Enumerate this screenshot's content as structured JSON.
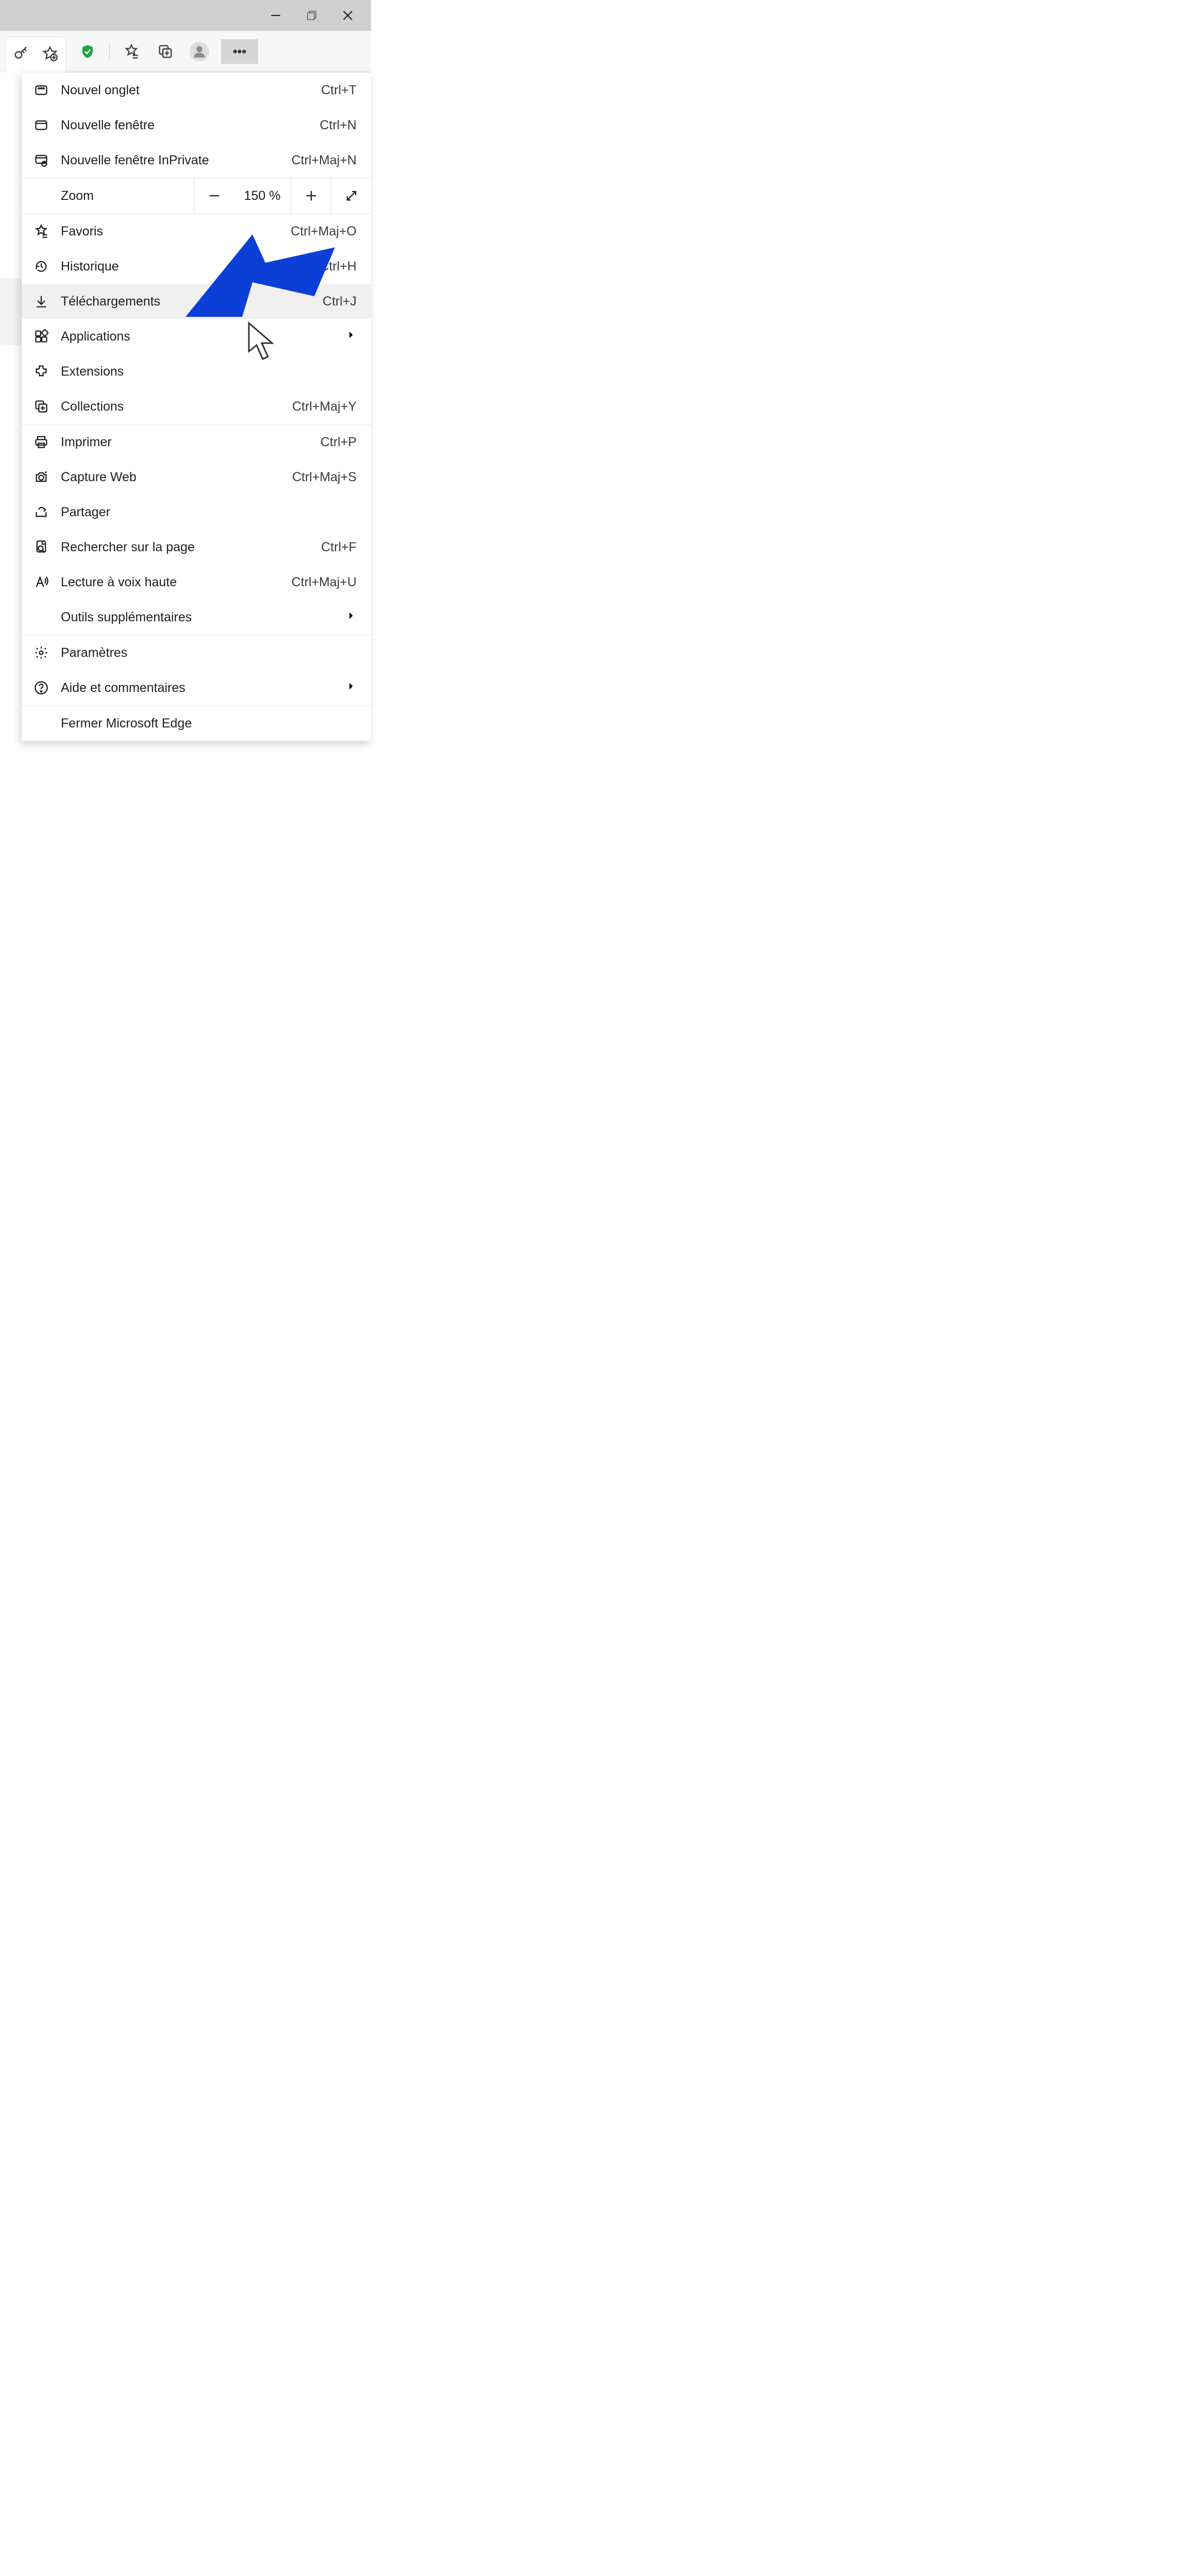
{
  "titlebar": {
    "min": "",
    "max": "",
    "close": ""
  },
  "toolbar": {},
  "zoom": {
    "label": "Zoom",
    "value": "150 %"
  },
  "menu": {
    "new_tab": {
      "label": "Nouvel onglet",
      "shortcut": "Ctrl+T"
    },
    "new_window": {
      "label": "Nouvelle fenêtre",
      "shortcut": "Ctrl+N"
    },
    "new_inprivate": {
      "label": "Nouvelle fenêtre InPrivate",
      "shortcut": "Ctrl+Maj+N"
    },
    "favorites": {
      "label": "Favoris",
      "shortcut": "Ctrl+Maj+O"
    },
    "history": {
      "label": "Historique",
      "shortcut": "Ctrl+H"
    },
    "downloads": {
      "label": "Téléchargements",
      "shortcut": "Ctrl+J"
    },
    "apps": {
      "label": "Applications"
    },
    "extensions": {
      "label": "Extensions"
    },
    "collections": {
      "label": "Collections",
      "shortcut": "Ctrl+Maj+Y"
    },
    "print": {
      "label": "Imprimer",
      "shortcut": "Ctrl+P"
    },
    "web_capture": {
      "label": "Capture Web",
      "shortcut": "Ctrl+Maj+S"
    },
    "share": {
      "label": "Partager"
    },
    "find": {
      "label": "Rechercher sur la page",
      "shortcut": "Ctrl+F"
    },
    "read_aloud": {
      "label": "Lecture à voix haute",
      "shortcut": "Ctrl+Maj+U"
    },
    "more_tools": {
      "label": "Outils supplémentaires"
    },
    "settings": {
      "label": "Paramètres"
    },
    "help": {
      "label": "Aide et commentaires"
    },
    "close_edge": {
      "label": "Fermer Microsoft Edge"
    }
  }
}
